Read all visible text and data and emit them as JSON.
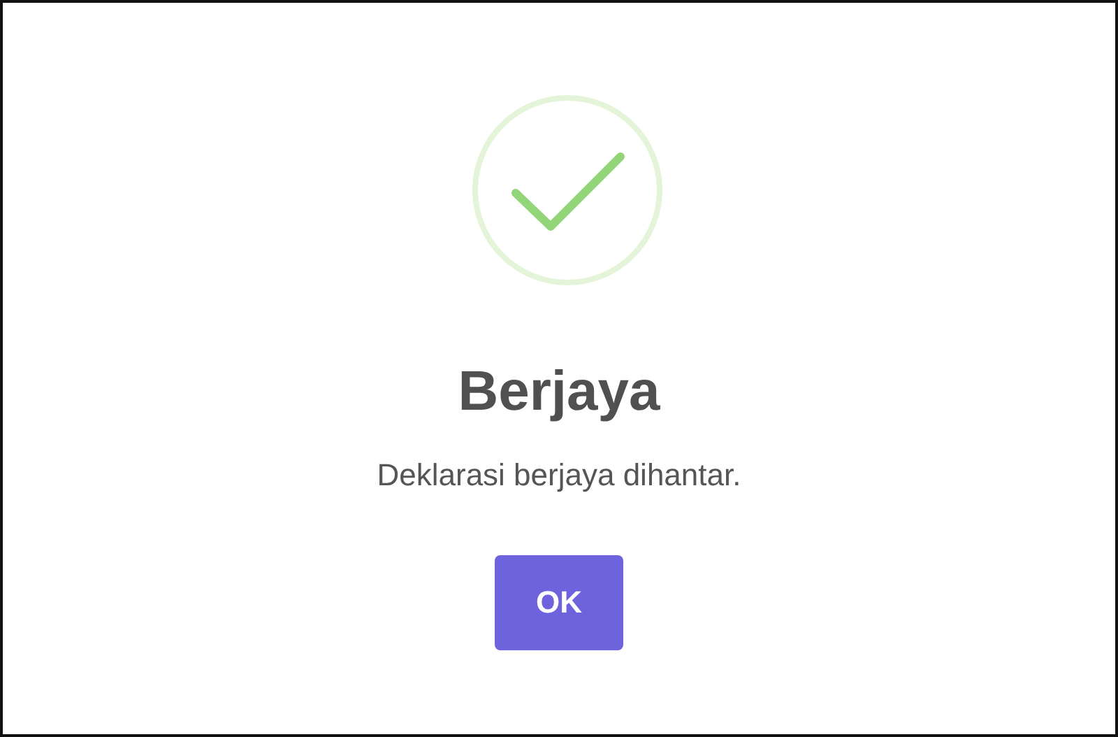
{
  "dialog": {
    "kind": "success",
    "title": "Berjaya",
    "message": "Deklarasi berjaya dihantar.",
    "buttons": [
      {
        "label": "OK"
      }
    ]
  }
}
